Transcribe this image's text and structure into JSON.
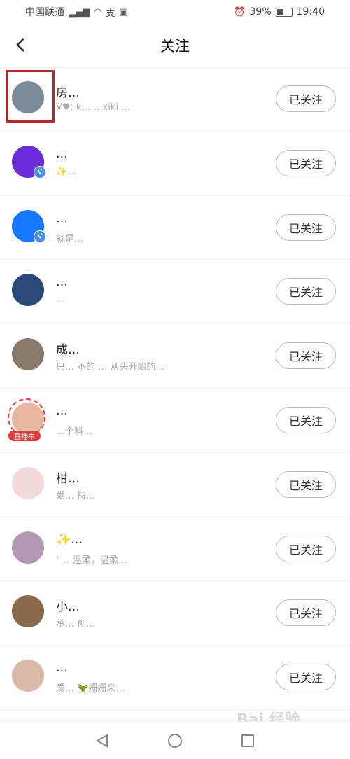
{
  "status_bar": {
    "carrier": "中国联通",
    "signal": "᷊ıll",
    "battery_pct": "39%",
    "time": "19:40",
    "battery_level": 0.39
  },
  "header": {
    "title": "关注"
  },
  "list": [
    {
      "name": "房…",
      "subtitle": "V♥: k…  …xiki …",
      "button": "已关注",
      "avatar_color": "#7a8c9a",
      "badge": ""
    },
    {
      "name": "…",
      "subtitle": "✨…",
      "button": "已关注",
      "avatar_color": "#6c2bd9",
      "badge": "V"
    },
    {
      "name": "…",
      "subtitle": "就是…",
      "button": "已关注",
      "avatar_color": "#1677ff",
      "badge": "V"
    },
    {
      "name": "…",
      "subtitle": "…",
      "button": "已关注",
      "avatar_color": "#2b4a7a",
      "badge": ""
    },
    {
      "name": "成…",
      "subtitle": "只… 不的 … 从头开始的…",
      "button": "已关注",
      "avatar_color": "#8a7a6a",
      "badge": ""
    },
    {
      "name": "…",
      "subtitle": "…个料…",
      "button": "已关注",
      "avatar_color": "#e9b7a0",
      "badge": "直播中"
    },
    {
      "name": "柑…",
      "subtitle": "爱… 持…",
      "button": "已关注",
      "avatar_color": "#f3d9d9",
      "badge": ""
    },
    {
      "name": "✨…",
      "subtitle": "“… 温柔，温柔…",
      "button": "已关注",
      "avatar_color": "#b59ab8",
      "badge": ""
    },
    {
      "name": "小…",
      "subtitle": "承…  创…",
      "button": "已关注",
      "avatar_color": "#8a6a4a",
      "badge": ""
    },
    {
      "name": "…",
      "subtitle": "爱…  🦖姗姗来…",
      "button": "已关注",
      "avatar_color": "#d9b8a8",
      "badge": ""
    }
  ],
  "nav": {
    "back_icon": "back-triangle",
    "home_icon": "home-circle",
    "recent_icon": "recent-square"
  },
  "watermark": "Bai 经验"
}
